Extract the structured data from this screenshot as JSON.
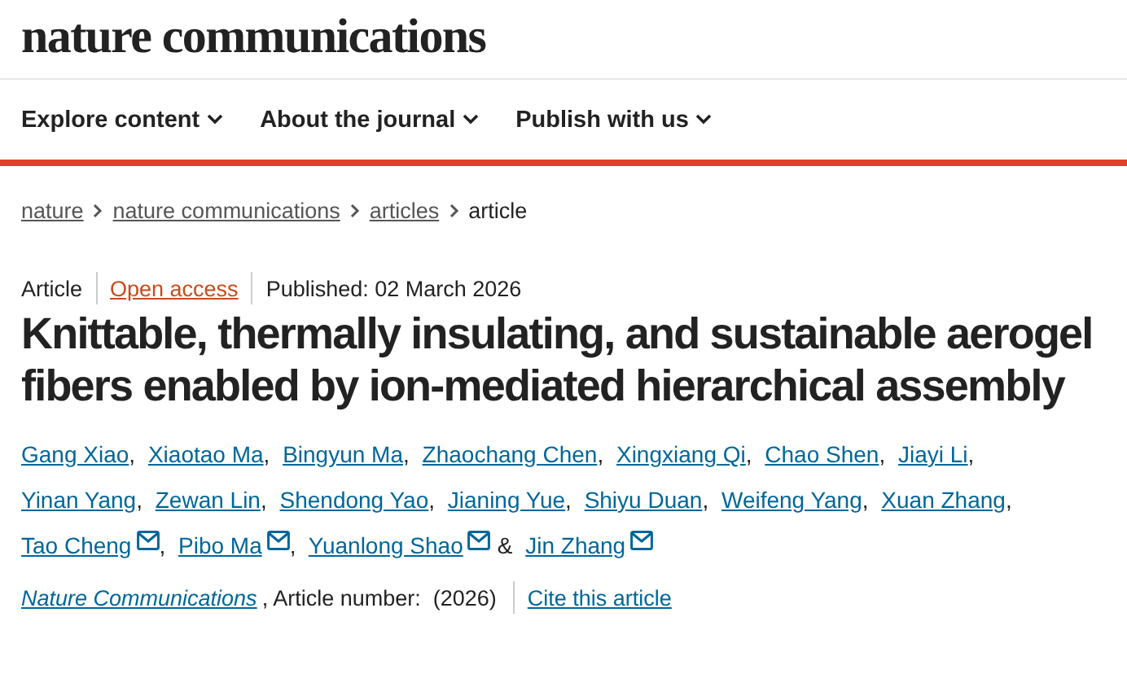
{
  "logo": "nature communications",
  "nav": [
    {
      "label": "Explore content",
      "expanded": false
    },
    {
      "label": "About the journal",
      "expanded": false
    },
    {
      "label": "Publish with us",
      "expanded": false
    }
  ],
  "breadcrumbs": [
    {
      "label": "nature",
      "current": false
    },
    {
      "label": "nature communications",
      "current": false
    },
    {
      "label": "articles",
      "current": false
    },
    {
      "label": "article",
      "current": true
    }
  ],
  "meta": {
    "type": "Article",
    "access": "Open access",
    "published": "Published: 02 March 2026"
  },
  "title": "Knittable, thermally insulating, and sustainable aerogel fibers enabled by ion-mediated hierarchical assembly",
  "authors": [
    {
      "name": "Gang Xiao",
      "corresponding": false,
      "after": ","
    },
    {
      "name": "Xiaotao Ma",
      "corresponding": false,
      "after": ","
    },
    {
      "name": "Bingyun Ma",
      "corresponding": false,
      "after": ","
    },
    {
      "name": "Zhaochang Chen",
      "corresponding": false,
      "after": ","
    },
    {
      "name": "Xingxiang Qi",
      "corresponding": false,
      "after": ","
    },
    {
      "name": "Chao Shen",
      "corresponding": false,
      "after": ","
    },
    {
      "name": "Jiayi Li",
      "corresponding": false,
      "after": ","
    },
    {
      "name": "Yinan Yang",
      "corresponding": false,
      "after": ","
    },
    {
      "name": "Zewan Lin",
      "corresponding": false,
      "after": ","
    },
    {
      "name": "Shendong Yao",
      "corresponding": false,
      "after": ","
    },
    {
      "name": "Jianing Yue",
      "corresponding": false,
      "after": ","
    },
    {
      "name": "Shiyu Duan",
      "corresponding": false,
      "after": ","
    },
    {
      "name": "Weifeng Yang",
      "corresponding": false,
      "after": ","
    },
    {
      "name": "Xuan Zhang",
      "corresponding": false,
      "after": ","
    },
    {
      "name": "Tao Cheng",
      "corresponding": true,
      "after": ","
    },
    {
      "name": "Pibo Ma",
      "corresponding": true,
      "after": ","
    },
    {
      "name": "Yuanlong Shao",
      "corresponding": true,
      "after": "&"
    },
    {
      "name": "Jin Zhang",
      "corresponding": true
    }
  ],
  "citation": {
    "journal": "Nature Communications",
    "number": ", Article number:  (2026)",
    "cite": "Cite this article"
  }
}
